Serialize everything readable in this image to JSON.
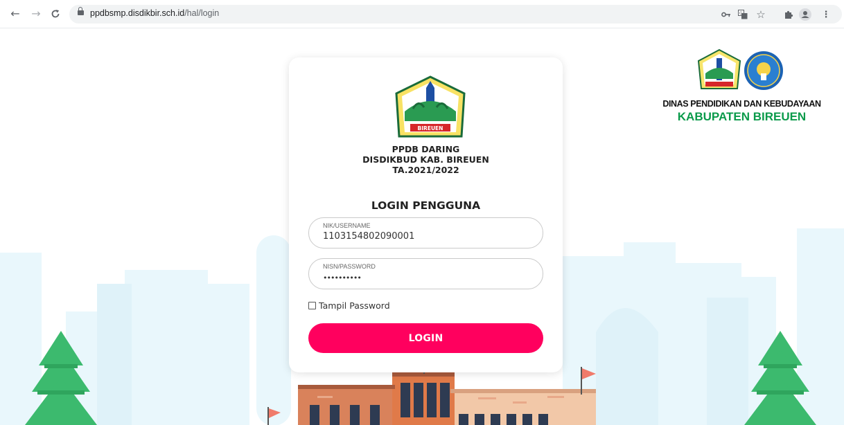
{
  "browser": {
    "url_domain": "ppdbsmp.disdikbir.sch.id",
    "url_path": "/hal/login",
    "nav": {
      "back_icon": "arrow-left-icon",
      "forward_icon": "arrow-right-icon",
      "reload_icon": "reload-icon"
    },
    "omnibox_icons": [
      "key-icon",
      "translate-icon",
      "star-icon"
    ],
    "toolbar_icons": [
      "extensions-icon",
      "profile-icon",
      "menu-icon"
    ]
  },
  "brand": {
    "line1": "DINAS PENDIDIKAN DAN KEBUDAYAAN",
    "line2": "KABUPATEN BIREUEN",
    "crest_text": "BIREUEN"
  },
  "login": {
    "crest_text": "BIREUEN",
    "title_lines": [
      "PPDB DARING",
      "DISDIKBUD KAB. BIREUEN",
      "TA.2021/2022"
    ],
    "heading": "LOGIN PENGGUNA",
    "username": {
      "label": "NIK/USERNAME",
      "value": "1103154802090001"
    },
    "password": {
      "label": "NISN/PASSWORD",
      "masked_value": "••••••••••"
    },
    "show_password": {
      "label": "Tampil Password",
      "checked": false
    },
    "submit_label": "LOGIN"
  },
  "colors": {
    "accent": "#ff005e",
    "brand_green": "#0a9a4a",
    "sky": "#e6f6fc",
    "tree": "#3cba6e"
  }
}
